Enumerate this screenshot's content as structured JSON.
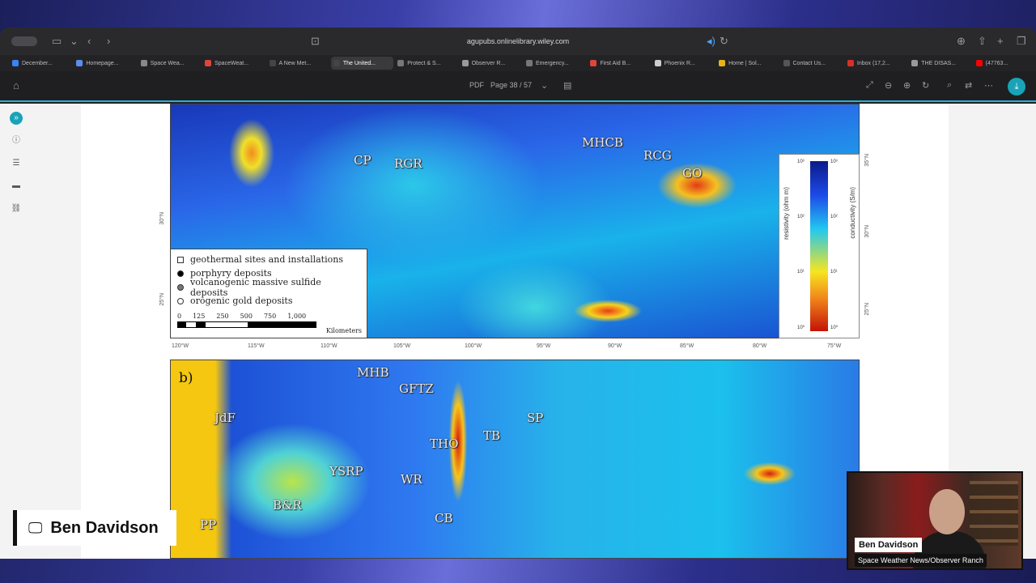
{
  "browser": {
    "url": "agupubs.onlinelibrary.wiley.com",
    "tabs": [
      {
        "label": "December...",
        "color": "#3b82f6"
      },
      {
        "label": "Homepage...",
        "color": "#5b8def"
      },
      {
        "label": "Space Wea...",
        "color": "#888888"
      },
      {
        "label": "SpaceWeat...",
        "color": "#e0453a"
      },
      {
        "label": "A New Met...",
        "color": "#444444"
      },
      {
        "label": "The United...",
        "color": "#444444"
      },
      {
        "label": "Protect & S...",
        "color": "#777777"
      },
      {
        "label": "Observer R...",
        "color": "#999999"
      },
      {
        "label": "Emergency...",
        "color": "#777777"
      },
      {
        "label": "First Aid B...",
        "color": "#e0453a"
      },
      {
        "label": "Phoenix R...",
        "color": "#cccccc"
      },
      {
        "label": "Home | Sol...",
        "color": "#e8b21a"
      },
      {
        "label": "Contact Us...",
        "color": "#555555"
      },
      {
        "label": "Inbox (17,2...",
        "color": "#d93025"
      },
      {
        "label": "THE DISAS...",
        "color": "#999999"
      },
      {
        "label": "(47763...",
        "color": "#ff0000"
      }
    ]
  },
  "pdf_toolbar": {
    "badge": "PDF",
    "page_indicator": "Page 38 / 57"
  },
  "figure": {
    "panel_b_label": "b)",
    "panel_a_regions": [
      "CP",
      "RGR",
      "MHCB",
      "RCG",
      "GO"
    ],
    "panel_b_regions": [
      "MHB",
      "GFTZ",
      "JdF",
      "SP",
      "TB",
      "THO",
      "YSRP",
      "WR",
      "B&R",
      "CB",
      "PP"
    ],
    "legend": [
      {
        "label": "geothermal sites and installations",
        "symbol": "square-white"
      },
      {
        "label": "porphyry deposits",
        "symbol": "circle-black"
      },
      {
        "label": "volcanogenic massive sulfide deposits",
        "symbol": "circle-gray"
      },
      {
        "label": "orogenic gold deposits",
        "symbol": "circle-white"
      }
    ],
    "scale_ticks": [
      "0",
      "125",
      "250",
      "500",
      "750",
      "1,000"
    ],
    "scale_unit": "Kilometers",
    "colorbar": {
      "left_title": "resistivity (ohm m)",
      "right_title": "conductivity (S/m)",
      "left_ticks": [
        "10⁰",
        "10¹",
        "10²",
        "10³"
      ],
      "right_ticks": [
        "10³",
        "10²",
        "10¹",
        "10⁰"
      ]
    },
    "x_ticks": [
      "120°W",
      "115°W",
      "110°W",
      "105°W",
      "100°W",
      "95°W",
      "90°W",
      "85°W",
      "80°W",
      "75°W"
    ],
    "y_ticks": [
      "35°N",
      "30°N",
      "25°N"
    ]
  },
  "presenter": {
    "name": "Ben Davidson",
    "cam_name": "Ben Davidson",
    "cam_subtitle": "Space Weather News/Observer Ranch"
  }
}
